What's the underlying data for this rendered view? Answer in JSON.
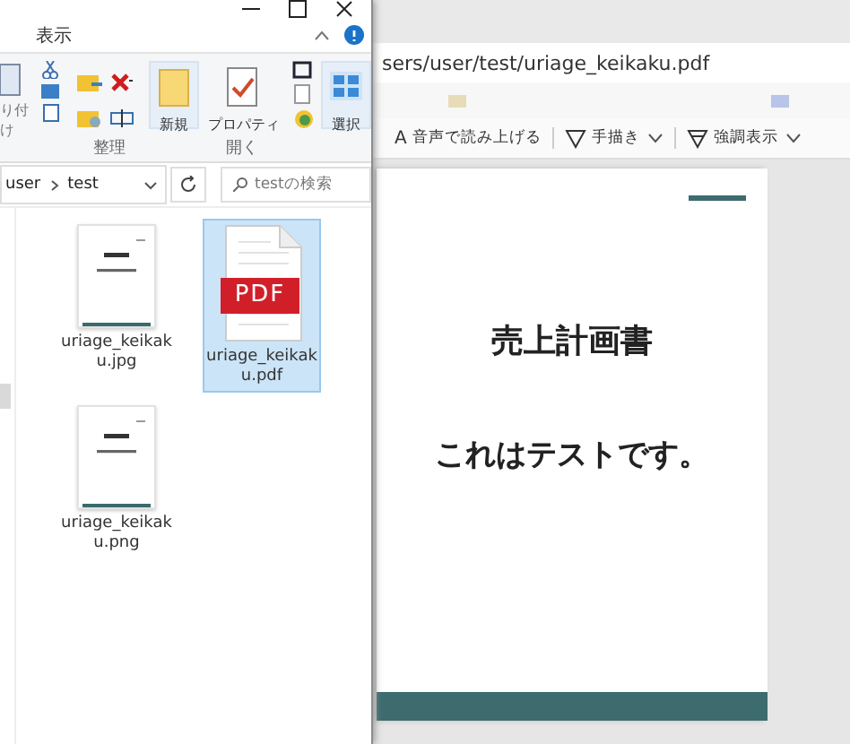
{
  "explorer": {
    "menu_tabs": [
      {
        "label": "表示",
        "selected": false
      }
    ],
    "ribbon": {
      "paste_label": "り付け",
      "groups": [
        {
          "label": "整理"
        },
        {
          "label": "開く"
        }
      ],
      "buttons": [
        {
          "label": "新規",
          "kind": "new"
        },
        {
          "label": "プロパティ",
          "kind": "properties"
        },
        {
          "label": "選択",
          "kind": "select"
        }
      ]
    },
    "breadcrumb": [
      "user",
      "test"
    ],
    "search": {
      "placeholder": "testの検索"
    },
    "files": [
      {
        "name": "uriage_keikaku.jpg",
        "kind": "image",
        "selected": false
      },
      {
        "name": "uriage_keikaku.pdf",
        "kind": "pdf",
        "badge": "PDF",
        "selected": true
      },
      {
        "name": "uriage_keikaku.png",
        "kind": "image",
        "selected": false
      }
    ]
  },
  "viewer": {
    "address": "sers/user/test/uriage_keikaku.pdf",
    "toolbar": [
      {
        "label": "音声で読み上げる",
        "kind": "read",
        "glyph": "A"
      },
      {
        "label": "手描き",
        "kind": "draw"
      },
      {
        "label": "強調表示",
        "kind": "highlight"
      }
    ],
    "page": {
      "title": "売上計画書",
      "body": "これはテストです。"
    }
  }
}
